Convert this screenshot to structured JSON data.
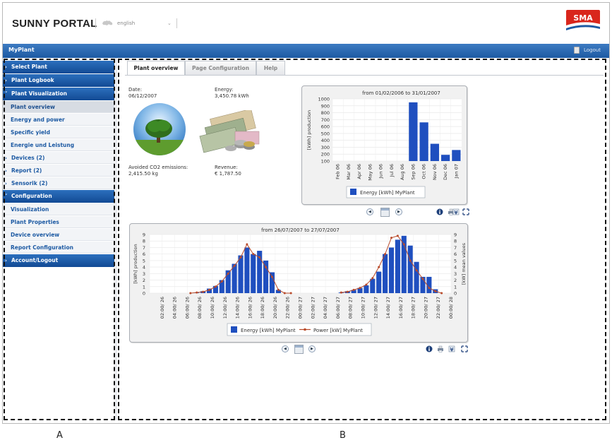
{
  "header": {
    "portal_title": "SUNNY PORTAL",
    "language": "english",
    "brand": "SMA"
  },
  "plant_bar": {
    "plant_name": "MyPlant",
    "logout_label": "Logout"
  },
  "sidebar": {
    "items": [
      {
        "label": "Select Plant",
        "kind": "main",
        "caret": "›"
      },
      {
        "label": "Plant Logbook",
        "kind": "main",
        "caret": "›"
      },
      {
        "label": "Plant Visualization",
        "kind": "main",
        "caret": "˅"
      },
      {
        "label": "Plant overview",
        "kind": "sub",
        "active": true
      },
      {
        "label": "Energy and power",
        "kind": "sub"
      },
      {
        "label": "Specific yield",
        "kind": "sub"
      },
      {
        "label": "Energie und Leistung",
        "kind": "sub"
      },
      {
        "label": "Devices (2)",
        "kind": "dev",
        "caret": "›"
      },
      {
        "label": "Report (2)",
        "kind": "dev",
        "caret": "›"
      },
      {
        "label": "Sensorik (2)",
        "kind": "dev",
        "caret": "›"
      },
      {
        "label": "Configuration",
        "kind": "main",
        "caret": "˅"
      },
      {
        "label": "Visualization",
        "kind": "sub"
      },
      {
        "label": "Plant Properties",
        "kind": "sub"
      },
      {
        "label": "Device overview",
        "kind": "sub"
      },
      {
        "label": "Report Configuration",
        "kind": "sub"
      },
      {
        "label": "Account/Logout",
        "kind": "main",
        "caret": "›"
      }
    ]
  },
  "tabs": [
    {
      "label": "Plant overview",
      "active": true
    },
    {
      "label": "Page Configuration",
      "active": false
    },
    {
      "label": "Help",
      "active": false
    }
  ],
  "overview": {
    "date_label": "Date:",
    "date_value": "06/12/2007",
    "energy_label": "Energy:",
    "energy_value": "3,450.78 kWh",
    "co2_label": "Avoided CO2 emissions:",
    "co2_value": "2,415.50 kg",
    "revenue_label": "Revenue:",
    "revenue_value": "€ 1,787.50"
  },
  "region_labels": {
    "a": "A",
    "b": "B"
  },
  "colors": {
    "nav_blue": "#1d5aa3",
    "bar_blue": "#1f4fbf",
    "power_line": "#b84a2a",
    "brand_red": "#d9261c"
  },
  "icons": {
    "controls": [
      "prev-icon",
      "calendar-icon",
      "next-icon"
    ],
    "tools": [
      "info-icon",
      "print-icon",
      "export-icon",
      "fullscreen-icon"
    ]
  },
  "chart_data": [
    {
      "type": "bar",
      "title": "from 01/02/2006 to 31/01/2007",
      "ylabel": "[kWh] production",
      "categories": [
        "Feb 06",
        "Mar 06",
        "Apr 06",
        "May 06",
        "Jun 06",
        "Jul 06",
        "Aug 06",
        "Sep 06",
        "Oct 06",
        "Nov 06",
        "Dec 06",
        "Jan 07"
      ],
      "series": [
        {
          "name": "Energy [kWh] MyPlant",
          "values": [
            0,
            0,
            0,
            0,
            0,
            0,
            0,
            950,
            660,
            350,
            190,
            260
          ]
        }
      ],
      "ylim": [
        100,
        1000
      ],
      "yticks": [
        100,
        200,
        300,
        400,
        500,
        600,
        700,
        800,
        900,
        1000
      ],
      "grid": true,
      "legend": "bottom"
    },
    {
      "type": "bar",
      "title": "from 26/07/2007 to 27/07/2007",
      "ylabel": "[kWh] production",
      "y2label": "[kW] mean values",
      "x_tick_labels": [
        "02:00/ 26",
        "04:00/ 26",
        "06:00/ 26",
        "08:00/ 26",
        "10:00/ 26",
        "12:00/ 26",
        "14:00/ 26",
        "16:00/ 26",
        "18:00/ 26",
        "20:00/ 26",
        "22:00/ 26",
        "00:00/ 27",
        "02:00/ 27",
        "04:00/ 27",
        "06:00/ 27",
        "08:00/ 27",
        "10:00/ 27",
        "12:00/ 27",
        "14:00/ 27",
        "16:00/ 27",
        "18:00/ 27",
        "20:00/ 27",
        "22:00/ 27",
        "00:00/ 28"
      ],
      "hours": [
        6,
        7,
        8,
        9,
        10,
        11,
        12,
        13,
        14,
        15,
        16,
        17,
        18,
        19,
        20,
        21,
        22,
        30,
        31,
        32,
        33,
        34,
        35,
        36,
        37,
        38,
        39,
        40,
        41,
        42,
        43,
        44,
        45,
        46
      ],
      "series": [
        {
          "name": "Energy [kWh] MyPlant",
          "type": "bar",
          "values": [
            0,
            0.1,
            0.3,
            0.7,
            1.1,
            2,
            3.5,
            4.5,
            5.8,
            7,
            6,
            6.5,
            5,
            3.2,
            0.5,
            0,
            0,
            0.1,
            0.3,
            0.5,
            0.8,
            1.2,
            2.2,
            3.3,
            6,
            7,
            8.2,
            8.8,
            7.3,
            4.8,
            2.5,
            2.5,
            0.6,
            0
          ],
          "hours": [
            6,
            7,
            8,
            9,
            10,
            11,
            12,
            13,
            14,
            15,
            16,
            17,
            18,
            19,
            20,
            21,
            22,
            30,
            31,
            32,
            33,
            34,
            35,
            36,
            37,
            38,
            39,
            40,
            41,
            42,
            43,
            44,
            45,
            46
          ]
        },
        {
          "name": "Power [kW] MyPlant",
          "type": "line",
          "values": [
            0,
            0.1,
            0.2,
            0.5,
            1,
            1.8,
            3,
            4.2,
            5.5,
            7.5,
            6,
            5.5,
            4,
            2.5,
            0.5,
            0,
            0,
            0.1,
            0.2,
            0.5,
            0.8,
            1.3,
            2.3,
            4,
            6,
            8.5,
            8.8,
            7.5,
            5,
            3.5,
            2.2,
            0.8,
            0.3,
            0
          ],
          "hours": [
            6,
            7,
            8,
            9,
            10,
            11,
            12,
            13,
            14,
            15,
            16,
            17,
            18,
            19,
            20,
            21,
            22,
            30,
            31,
            32,
            33,
            34,
            35,
            36,
            37,
            38,
            39,
            40,
            41,
            42,
            43,
            44,
            45,
            46
          ]
        }
      ],
      "ylim": [
        0,
        9
      ],
      "yticks": [
        0,
        1,
        2,
        3,
        4,
        5,
        6,
        7,
        8,
        9
      ],
      "grid": true,
      "legend": "bottom"
    }
  ]
}
